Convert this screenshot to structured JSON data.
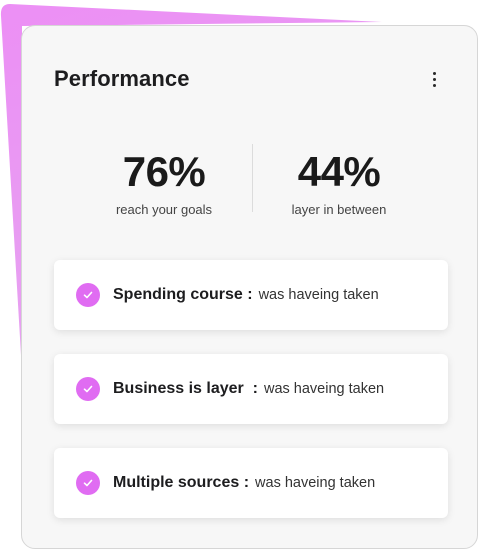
{
  "card": {
    "title": "Performance",
    "more_icon": "more-vertical-icon"
  },
  "stats": [
    {
      "value": "76%",
      "label": "reach your goals"
    },
    {
      "value": "44%",
      "label": "layer in between"
    }
  ],
  "items": [
    {
      "title": "Spending course :",
      "text": "was haveing taken",
      "icon": "check-circle-icon"
    },
    {
      "title": "Business is layer  :",
      "text": "was haveing taken",
      "icon": "check-circle-icon"
    },
    {
      "title": "Multiple sources :",
      "text": "was haveing taken",
      "icon": "check-circle-icon"
    }
  ],
  "colors": {
    "accent": "#e06cf2",
    "backdrop": "#e88cf3",
    "card_background": "#f7f7f7",
    "item_background": "#ffffff"
  }
}
